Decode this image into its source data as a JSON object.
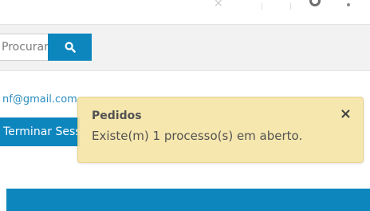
{
  "header": {
    "icons": [
      "close-icon",
      "account-icon",
      "more-icon"
    ]
  },
  "search": {
    "placeholder": "Procurar?",
    "button_icon": "search-icon"
  },
  "user": {
    "email": "nf@gmail.com",
    "logout_label": "Terminar Sessão"
  },
  "toast": {
    "title": "Pedidos",
    "message": "Existe(m) 1 processo(s) em aberto.",
    "close_label": "×"
  },
  "colors": {
    "brand_blue": "#0d86be",
    "toast_background": "#f6e5a8",
    "link_blue": "#2a8dbf"
  }
}
